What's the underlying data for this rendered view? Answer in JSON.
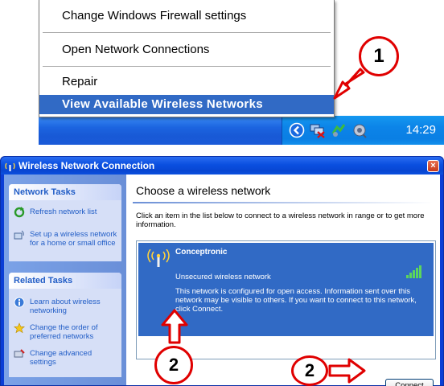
{
  "context_menu": {
    "items": [
      {
        "label": "Change Windows Firewall settings"
      },
      {
        "label": "Open Network Connections"
      },
      {
        "label": "Repair"
      },
      {
        "label": "View Available Wireless Networks"
      }
    ]
  },
  "taskbar": {
    "clock": "14:29",
    "tray_icons": [
      "show-hidden-icons-chevron",
      "wireless-network-disconnected-icon",
      "safely-remove-hardware-icon",
      "volume-icon"
    ]
  },
  "window": {
    "title": "Wireless Network Connection",
    "close_label": "×"
  },
  "network_tasks": {
    "heading": "Network Tasks",
    "items": [
      {
        "label": "Refresh network list"
      },
      {
        "label": "Set up a wireless network for a home or small office"
      }
    ]
  },
  "related_tasks": {
    "heading": "Related Tasks",
    "items": [
      {
        "label": "Learn about wireless networking"
      },
      {
        "label": "Change the order of preferred networks"
      },
      {
        "label": "Change advanced settings"
      }
    ]
  },
  "main": {
    "title": "Choose a wireless network",
    "description": "Click an item in the list below to connect to a wireless network in range or to get more information.",
    "networks": [
      {
        "name": "Conceptronic",
        "status": "Unsecured wireless network",
        "info": "This network is configured for open access. Information sent over this network may be visible to others. If you want to connect to this network, click Connect."
      }
    ],
    "connect_label": "Connect"
  },
  "callouts": {
    "step1": "1",
    "step2a": "2",
    "step2b": "2"
  },
  "colors": {
    "annotation_red": "#e00000",
    "selection_blue": "#316ac5",
    "taskbar_blue": "#1c64e0"
  }
}
